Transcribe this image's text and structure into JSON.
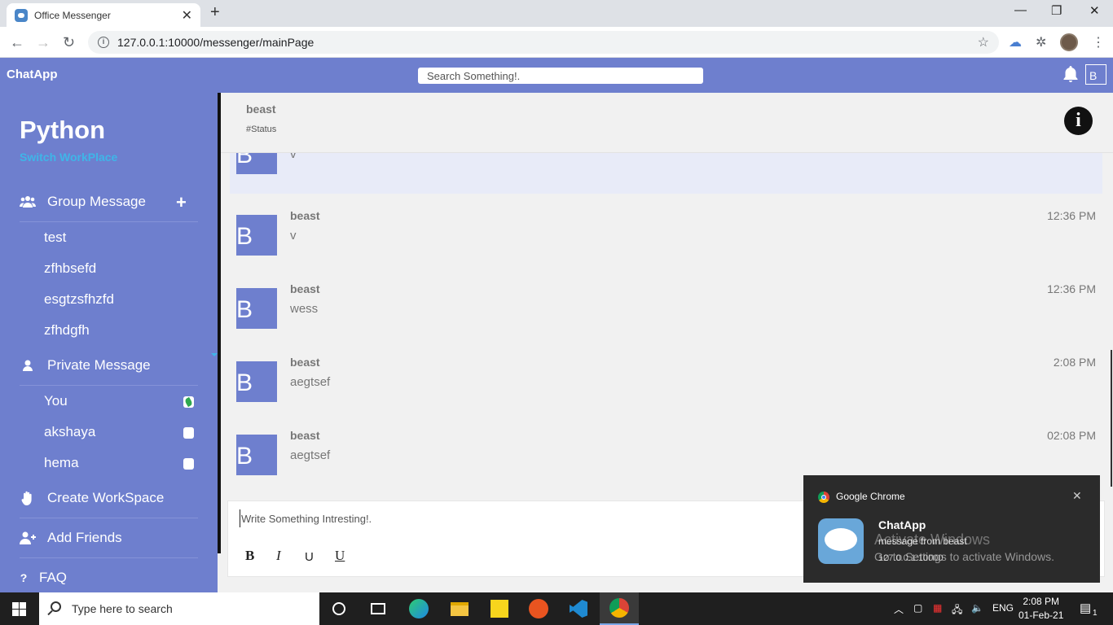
{
  "browser": {
    "tab_title": "Office Messenger",
    "url": "127.0.0.1:10000/messenger/mainPage"
  },
  "header": {
    "brand": "ChatApp",
    "search_placeholder": "Search Something!.",
    "user_initial": "B"
  },
  "sidebar": {
    "workspace": "Python",
    "switch_label": "Switch WorkPlace",
    "group_label": "Group Message",
    "groups": [
      "test",
      "zfhbsefd",
      "esgtzsfhzfd",
      "zfhdgfh"
    ],
    "private_label": "Private Message",
    "contacts": [
      {
        "name": "You",
        "online": true
      },
      {
        "name": "akshaya",
        "online": false
      },
      {
        "name": "hema",
        "online": false
      }
    ],
    "create_label": "Create WorkSpace",
    "add_friends_label": "Add Friends",
    "faq_label": "FAQ"
  },
  "chat": {
    "name": "beast",
    "status": "#Status",
    "messages": [
      {
        "initial": "B",
        "name": "",
        "text": "v",
        "time": ""
      },
      {
        "initial": "B",
        "name": "beast",
        "text": "v",
        "time": "12:36 PM"
      },
      {
        "initial": "B",
        "name": "beast",
        "text": "wess",
        "time": "12:36 PM"
      },
      {
        "initial": "B",
        "name": "beast",
        "text": "aegtsef",
        "time": "2:08 PM"
      },
      {
        "initial": "B",
        "name": "beast",
        "text": "aegtsef",
        "time": "02:08 PM"
      }
    ]
  },
  "composer": {
    "placeholder": "Write Something Intresting!.",
    "bold": "B",
    "italic": "I",
    "underline": "U",
    "underline2": "U"
  },
  "notification": {
    "source": "Google Chrome",
    "title": "ChatApp",
    "message": "message from beast",
    "origin": "127.0.0.1:10000",
    "watermark_title": "Activate Windows",
    "watermark_sub": "Go to Settings to activate Windows."
  },
  "taskbar": {
    "search_placeholder": "Type here to search",
    "lang": "ENG",
    "time": "2:08 PM",
    "date": "01-Feb-21",
    "notification_count": "1"
  }
}
